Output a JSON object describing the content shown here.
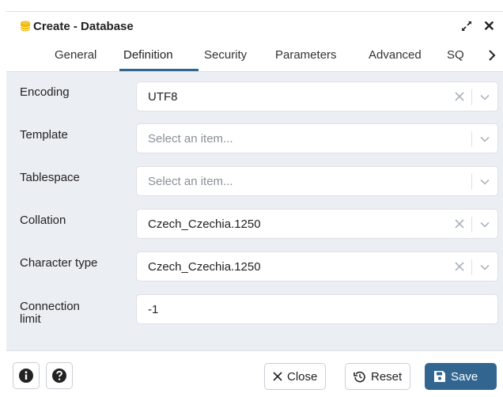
{
  "dialog": {
    "title": "Create - Database",
    "icons": {
      "database": "database-icon",
      "expand": "expand-icon",
      "close": "close-icon"
    },
    "close_glyph": "✕"
  },
  "tabs": {
    "items": [
      {
        "label": "General"
      },
      {
        "label": "Definition",
        "active": true
      },
      {
        "label": "Security"
      },
      {
        "label": "Parameters"
      },
      {
        "label": "Advanced"
      },
      {
        "label": "SQ"
      }
    ],
    "next_glyph": "›"
  },
  "form": {
    "encoding": {
      "label": "Encoding",
      "value": "UTF8"
    },
    "template": {
      "label": "Template",
      "placeholder": "Select an item..."
    },
    "tablespace": {
      "label": "Tablespace",
      "placeholder": "Select an item..."
    },
    "collation": {
      "label": "Collation",
      "value": "Czech_Czechia.1250"
    },
    "character_type": {
      "label": "Character type",
      "value": "Czech_Czechia.1250"
    },
    "connection_limit": {
      "label_line1": "Connection",
      "label_line2": "limit",
      "value": "-1"
    }
  },
  "footer": {
    "info_icon": "info-icon",
    "help_icon": "help-icon",
    "close_label": "Close",
    "reset_label": "Reset",
    "save_label": "Save"
  },
  "colors": {
    "accent": "#326690",
    "panel_bg": "#ebeef3",
    "border": "#dde0e6"
  }
}
